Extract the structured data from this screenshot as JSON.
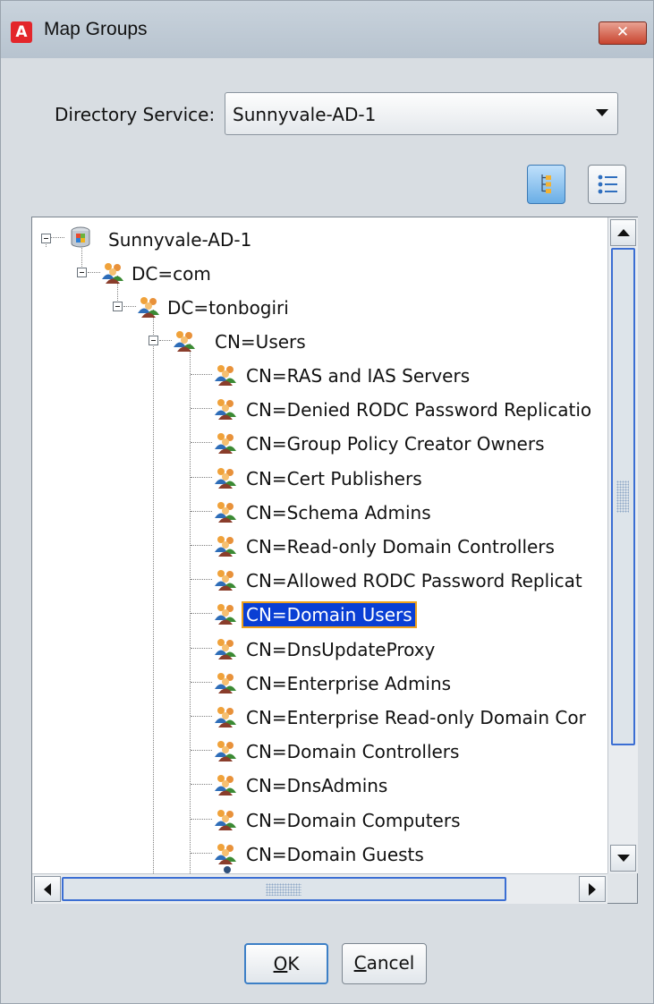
{
  "window": {
    "title": "Map Groups",
    "app_icon_letter": "A",
    "close_glyph": "✕"
  },
  "directory_service": {
    "label": "Directory Service:",
    "selected": "Sunnyvale-AD-1"
  },
  "view_toggle": {
    "tree_view_active": true,
    "tree_icon": "tree-view-icon",
    "list_icon": "list-view-icon"
  },
  "tree": {
    "root": "Sunnyvale-AD-1",
    "dc_com": "DC=com",
    "dc_tonbogiri": "DC=tonbogiri",
    "cn_users": "CN=Users",
    "groups": [
      "CN=RAS and IAS Servers",
      "CN=Denied RODC Password Replicatio",
      "CN=Group Policy Creator Owners",
      "CN=Cert Publishers",
      "CN=Schema Admins",
      "CN=Read-only Domain Controllers",
      "CN=Allowed RODC Password Replicat",
      "CN=Domain Users",
      "CN=DnsUpdateProxy",
      "CN=Enterprise Admins",
      "CN=Enterprise Read-only Domain Cor",
      "CN=Domain Controllers",
      "CN=DnsAdmins",
      "CN=Domain Computers",
      "CN=Domain Guests"
    ],
    "selected_group": "CN=Domain Users"
  },
  "buttons": {
    "ok": "OK",
    "cancel": "Cancel"
  },
  "colors": {
    "selection": "#0a3fd4",
    "selection_outline": "#f0a21a",
    "app_icon": "#e3262b"
  }
}
